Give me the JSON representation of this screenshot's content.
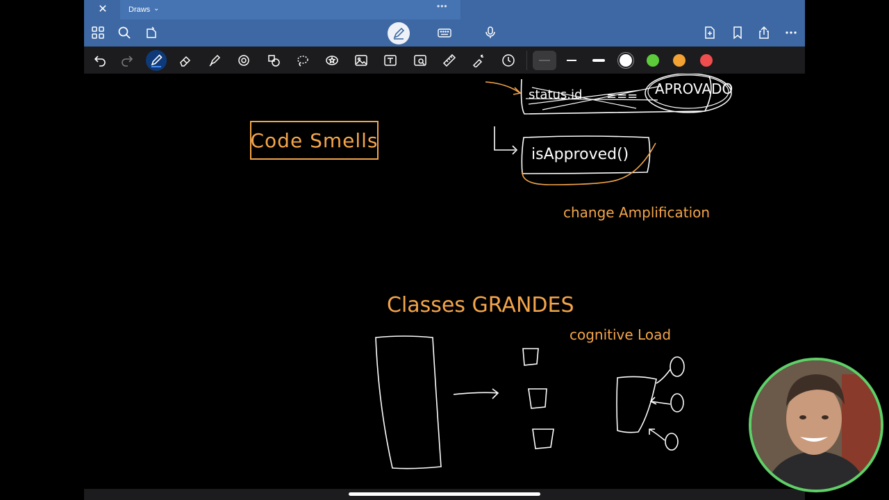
{
  "window": {
    "close_symbol": "✕"
  },
  "tab": {
    "title": "Draws",
    "chevron": "⌄",
    "dots": "•••"
  },
  "toolbar_top": {
    "left_icons": [
      "grid-icon",
      "search-icon",
      "bookmark-badge-icon"
    ],
    "center_icons": [
      "pen-mode-icon",
      "keyboard-icon",
      "microphone-icon"
    ],
    "right_icons": [
      "add-page-icon",
      "bookmark-icon",
      "share-icon",
      "more-icon"
    ]
  },
  "tools": [
    "undo-icon",
    "redo-icon",
    "pen-icon",
    "eraser-icon",
    "highlighter-icon",
    "shapes-icon",
    "element-icon",
    "lasso-icon",
    "sticker-icon",
    "image-icon",
    "text-icon",
    "scan-icon",
    "ruler-icon",
    "laser-icon",
    "clock-icon"
  ],
  "stroke_widths": [
    "thin",
    "medium",
    "thick"
  ],
  "colors": {
    "white": "#ffffff",
    "green": "#5ccc3b",
    "orange": "#f4a233",
    "red": "#f04e4e",
    "ink_orange": "#f4a54a",
    "toolbar_blue": "#3d68a4"
  },
  "canvas": {
    "box_title": "Code Smells",
    "strike_left": "status.id",
    "strike_eq": "===",
    "strike_right": "APROVADO",
    "method": "isApproved()",
    "change": "change Amplification",
    "section": "Classes GRANDES",
    "cognitive": "cognitive Load"
  }
}
